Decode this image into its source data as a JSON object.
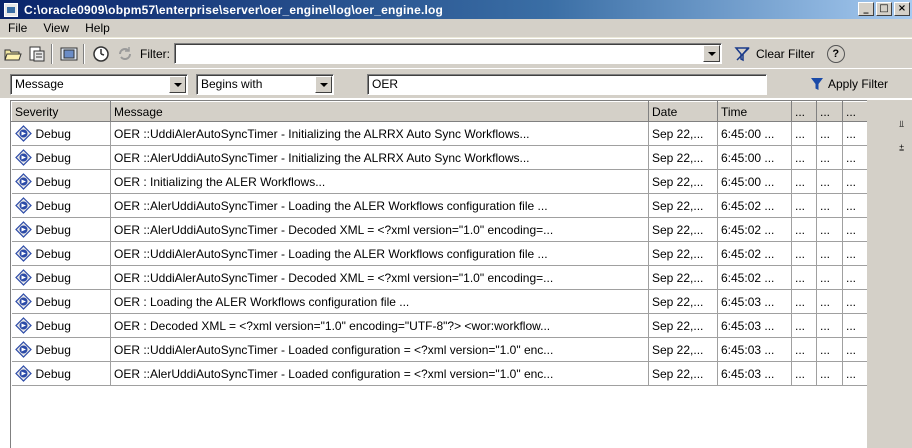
{
  "window": {
    "title": "C:\\oracle0909\\obpm57\\enterprise\\server\\oer_engine\\log\\oer_engine.log",
    "controls": [
      "_",
      "□",
      "×"
    ]
  },
  "menu": [
    "File",
    "View",
    "Help"
  ],
  "toolbar": {
    "filter_label": "Filter:",
    "filter_value": "",
    "clear_filter_label": "Clear Filter",
    "help_label": "?"
  },
  "filterbar": {
    "field": "Message",
    "operator": "Begins with",
    "value": "OER",
    "apply_label": "Apply Filter"
  },
  "table": {
    "columns": [
      "Severity",
      "Message",
      "Date",
      "Time",
      "...",
      "...",
      "..."
    ],
    "rows": [
      {
        "severity": "Debug",
        "message": "OER ::UddiAlerAutoSyncTimer - Initializing the ALRRX Auto Sync Workflows...",
        "date": "Sep 22,...",
        "time": "6:45:00 ...",
        "c5": "...",
        "c6": "...",
        "c7": "..."
      },
      {
        "severity": "Debug",
        "message": "OER ::AlerUddiAutoSyncTimer - Initializing the ALRRX Auto Sync Workflows...",
        "date": "Sep 22,...",
        "time": "6:45:00 ...",
        "c5": "...",
        "c6": "...",
        "c7": "..."
      },
      {
        "severity": "Debug",
        "message": "OER : Initializing the ALER Workflows...",
        "date": "Sep 22,...",
        "time": "6:45:00 ...",
        "c5": "...",
        "c6": "...",
        "c7": "..."
      },
      {
        "severity": "Debug",
        "message": "OER ::AlerUddiAutoSyncTimer - Loading the ALER Workflows configuration file ...",
        "date": "Sep 22,...",
        "time": "6:45:02 ...",
        "c5": "...",
        "c6": "...",
        "c7": "..."
      },
      {
        "severity": "Debug",
        "message": "OER ::AlerUddiAutoSyncTimer - Decoded XML = <?xml version=\"1.0\" encoding=...",
        "date": "Sep 22,...",
        "time": "6:45:02 ...",
        "c5": "...",
        "c6": "...",
        "c7": "..."
      },
      {
        "severity": "Debug",
        "message": "OER ::UddiAlerAutoSyncTimer - Loading the ALER Workflows configuration file ...",
        "date": "Sep 22,...",
        "time": "6:45:02 ...",
        "c5": "...",
        "c6": "...",
        "c7": "..."
      },
      {
        "severity": "Debug",
        "message": "OER ::UddiAlerAutoSyncTimer - Decoded XML = <?xml version=\"1.0\" encoding=...",
        "date": "Sep 22,...",
        "time": "6:45:02 ...",
        "c5": "...",
        "c6": "...",
        "c7": "..."
      },
      {
        "severity": "Debug",
        "message": "OER : Loading the ALER Workflows configuration file ...",
        "date": "Sep 22,...",
        "time": "6:45:03 ...",
        "c5": "...",
        "c6": "...",
        "c7": "..."
      },
      {
        "severity": "Debug",
        "message": "OER : Decoded XML = <?xml version=\"1.0\" encoding=\"UTF-8\"?> <wor:workflow...",
        "date": "Sep 22,...",
        "time": "6:45:03 ...",
        "c5": "...",
        "c6": "...",
        "c7": "..."
      },
      {
        "severity": "Debug",
        "message": "OER ::UddiAlerAutoSyncTimer - Loaded configuration = <?xml version=\"1.0\" enc...",
        "date": "Sep 22,...",
        "time": "6:45:03 ...",
        "c5": "...",
        "c6": "...",
        "c7": "..."
      },
      {
        "severity": "Debug",
        "message": "OER ::AlerUddiAutoSyncTimer - Loaded configuration = <?xml version=\"1.0\" enc...",
        "date": "Sep 22,...",
        "time": "6:45:03 ...",
        "c5": "...",
        "c6": "...",
        "c7": "..."
      }
    ]
  },
  "icons": {
    "app": "log-viewer-icon",
    "severity": "debug-icon",
    "toolbar": [
      "open-file-icon",
      "export-icon",
      "view-icon",
      "clock-icon",
      "refresh-icon"
    ]
  },
  "colors": {
    "titlebar_start": "#0a246a",
    "titlebar_end": "#a6caf0",
    "chrome": "#d4d0c8",
    "debug_icon": "#2b4aa8"
  }
}
